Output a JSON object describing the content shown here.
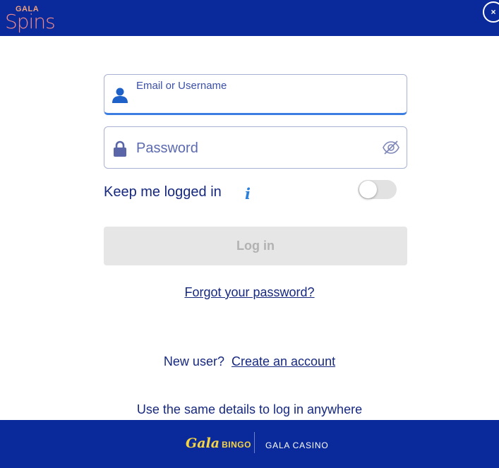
{
  "header": {
    "logo_top": "GALA",
    "logo_main": "Spins",
    "close_symbol": "×"
  },
  "login_form": {
    "email_label": "Email or Username",
    "email_value": "",
    "password_placeholder": "Password",
    "keep_logged_in_label": "Keep me logged in",
    "info_symbol": "i",
    "keep_logged_in_on": false,
    "login_button_label": "Log in",
    "forgot_password_link": "Forgot your password?"
  },
  "signup": {
    "prompt": "New user?",
    "link": "Create an account"
  },
  "same_details_text": "Use the same details to log in anywhere",
  "footer": {
    "bingo_brand": "Gala",
    "bingo_word": "BINGO",
    "casino_brand": "GALA CASINO"
  },
  "colors": {
    "header_bg": "#0a2a9c",
    "text_primary": "#16287f",
    "accent_blue": "#3b7de0",
    "button_disabled_bg": "#e6e6e6",
    "bingo_yellow": "#f7d540"
  },
  "icons": [
    "user-icon",
    "lock-icon",
    "eye-slash-icon",
    "info-icon",
    "close-icon"
  ]
}
